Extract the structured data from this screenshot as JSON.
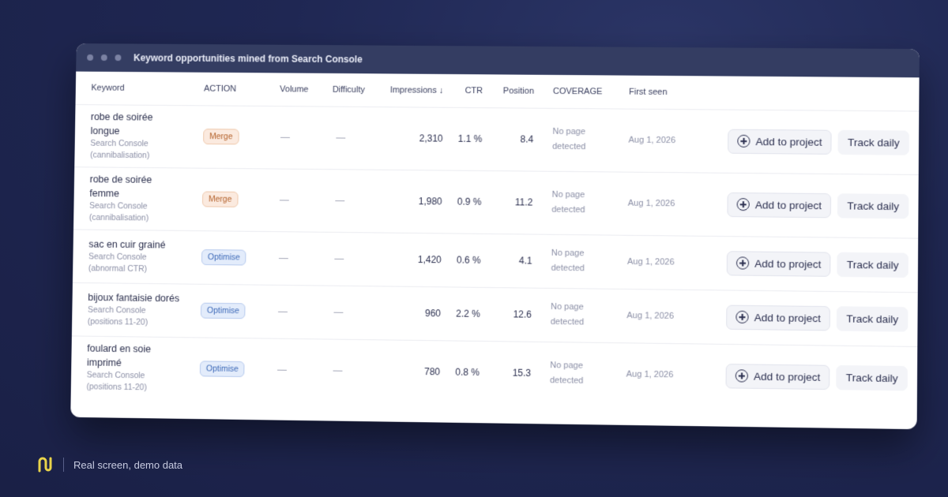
{
  "window": {
    "title": "Keyword opportunities mined from Search Console"
  },
  "table": {
    "headers": {
      "keyword": "Keyword",
      "action": "ACTION",
      "volume": "Volume",
      "difficulty": "Difficulty",
      "impressions": "Impressions ↓",
      "ctr": "CTR",
      "position": "Position",
      "coverage": "COVERAGE",
      "first_seen": "First seen"
    },
    "rows": [
      {
        "keyword_line1": "robe de soirée",
        "keyword_line2": "longue",
        "source_line1": "Search Console",
        "source_line2": "(cannibalisation)",
        "action": "Merge",
        "action_type": "merge",
        "volume": "—",
        "difficulty": "—",
        "impressions": "2,310",
        "ctr": "1.1 %",
        "position": "8.4",
        "coverage_line1": "No page",
        "coverage_line2": "detected",
        "first_seen": "Aug 1, 2026",
        "add_label": "Add to project",
        "track_label": "Track daily"
      },
      {
        "keyword_line1": "robe de soirée",
        "keyword_line2": "femme",
        "source_line1": "Search Console",
        "source_line2": "(cannibalisation)",
        "action": "Merge",
        "action_type": "merge",
        "volume": "—",
        "difficulty": "—",
        "impressions": "1,980",
        "ctr": "0.9 %",
        "position": "11.2",
        "coverage_line1": "No page",
        "coverage_line2": "detected",
        "first_seen": "Aug 1, 2026",
        "add_label": "Add to project",
        "track_label": "Track daily"
      },
      {
        "keyword_line1": "sac en cuir grainé",
        "keyword_line2": "",
        "source_line1": "Search Console",
        "source_line2": "(abnormal CTR)",
        "action": "Optimise",
        "action_type": "optimise",
        "volume": "—",
        "difficulty": "—",
        "impressions": "1,420",
        "ctr": "0.6 %",
        "position": "4.1",
        "coverage_line1": "No page",
        "coverage_line2": "detected",
        "first_seen": "Aug 1, 2026",
        "add_label": "Add to project",
        "track_label": "Track daily"
      },
      {
        "keyword_line1": "bijoux fantaisie dorés",
        "keyword_line2": "",
        "source_line1": "Search Console",
        "source_line2": "(positions 11-20)",
        "action": "Optimise",
        "action_type": "optimise",
        "volume": "—",
        "difficulty": "—",
        "impressions": "960",
        "ctr": "2.2 %",
        "position": "12.6",
        "coverage_line1": "No page",
        "coverage_line2": "detected",
        "first_seen": "Aug 1, 2026",
        "add_label": "Add to project",
        "track_label": "Track daily"
      },
      {
        "keyword_line1": "foulard en soie",
        "keyword_line2": "imprimé",
        "source_line1": "Search Console",
        "source_line2": "(positions 11-20)",
        "action": "Optimise",
        "action_type": "optimise",
        "volume": "—",
        "difficulty": "—",
        "impressions": "780",
        "ctr": "0.8 %",
        "position": "15.3",
        "coverage_line1": "No page",
        "coverage_line2": "detected",
        "first_seen": "Aug 1, 2026",
        "add_label": "Add to project",
        "track_label": "Track daily"
      }
    ]
  },
  "footer": {
    "text": "Real screen, demo data",
    "logo_icon": "brand-logo-icon"
  },
  "colors": {
    "background": "#1f2753",
    "titlebar": "#343d62",
    "merge_badge": "#b4622c",
    "optimise_badge": "#3f6bb8",
    "logo": "#e8d34a"
  }
}
